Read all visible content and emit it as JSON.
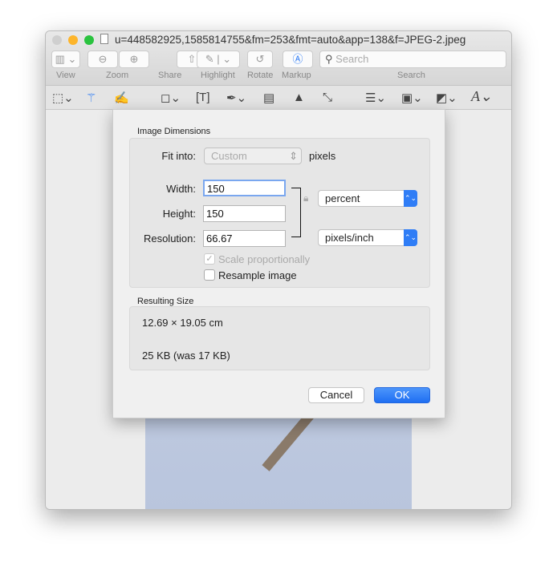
{
  "window": {
    "title": "u=448582925,1585814755&fm=253&fmt=auto&app=138&f=JPEG-2.jpeg"
  },
  "toolbar": {
    "view": "View",
    "zoom": "Zoom",
    "share": "Share",
    "highlight": "Highlight",
    "rotate": "Rotate",
    "markup": "Markup",
    "search_label": "Search",
    "search_placeholder": "Search"
  },
  "dialog": {
    "image_dimensions": "Image Dimensions",
    "fit_into_label": "Fit into:",
    "fit_into_value": "Custom",
    "fit_into_unit": "pixels",
    "width_label": "Width:",
    "width_value": "150",
    "height_label": "Height:",
    "height_value": "150",
    "resolution_label": "Resolution:",
    "resolution_value": "66.67",
    "size_unit": "percent",
    "resolution_unit": "pixels/inch",
    "scale_proportionally": "Scale proportionally",
    "scale_checked": true,
    "scale_disabled": true,
    "resample": "Resample image",
    "resample_checked": false,
    "resulting_size": "Resulting Size",
    "dimensions_result": "12.69 × 19.05 cm",
    "file_size_result": "25 KB (was 17 KB)",
    "cancel": "Cancel",
    "ok": "OK"
  },
  "colors": {
    "accent": "#2f7df6"
  }
}
